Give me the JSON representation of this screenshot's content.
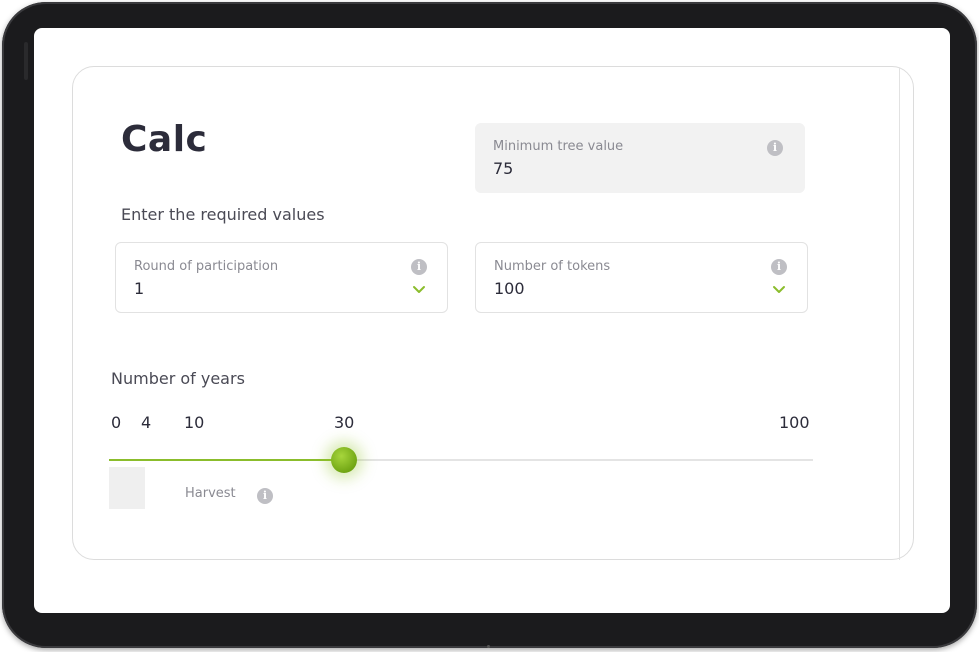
{
  "calc": {
    "title": "Calc",
    "subtitle": "Enter the required values"
  },
  "fields": {
    "min_tree_value": {
      "label": "Minimum tree value",
      "value": "75"
    },
    "round": {
      "label": "Round of participation",
      "value": "1"
    },
    "tokens": {
      "label": "Number of tokens",
      "value": "100"
    }
  },
  "years": {
    "label": "Number of years",
    "ticks": [
      "0",
      "4",
      "10",
      "30",
      "100"
    ],
    "value": 30,
    "harvest_label": "Harvest"
  },
  "icons": {
    "info": "info-icon",
    "chevron": "chevron-down-icon"
  },
  "colors": {
    "accent": "#8bbd2c",
    "title": "#2c2c3a"
  }
}
